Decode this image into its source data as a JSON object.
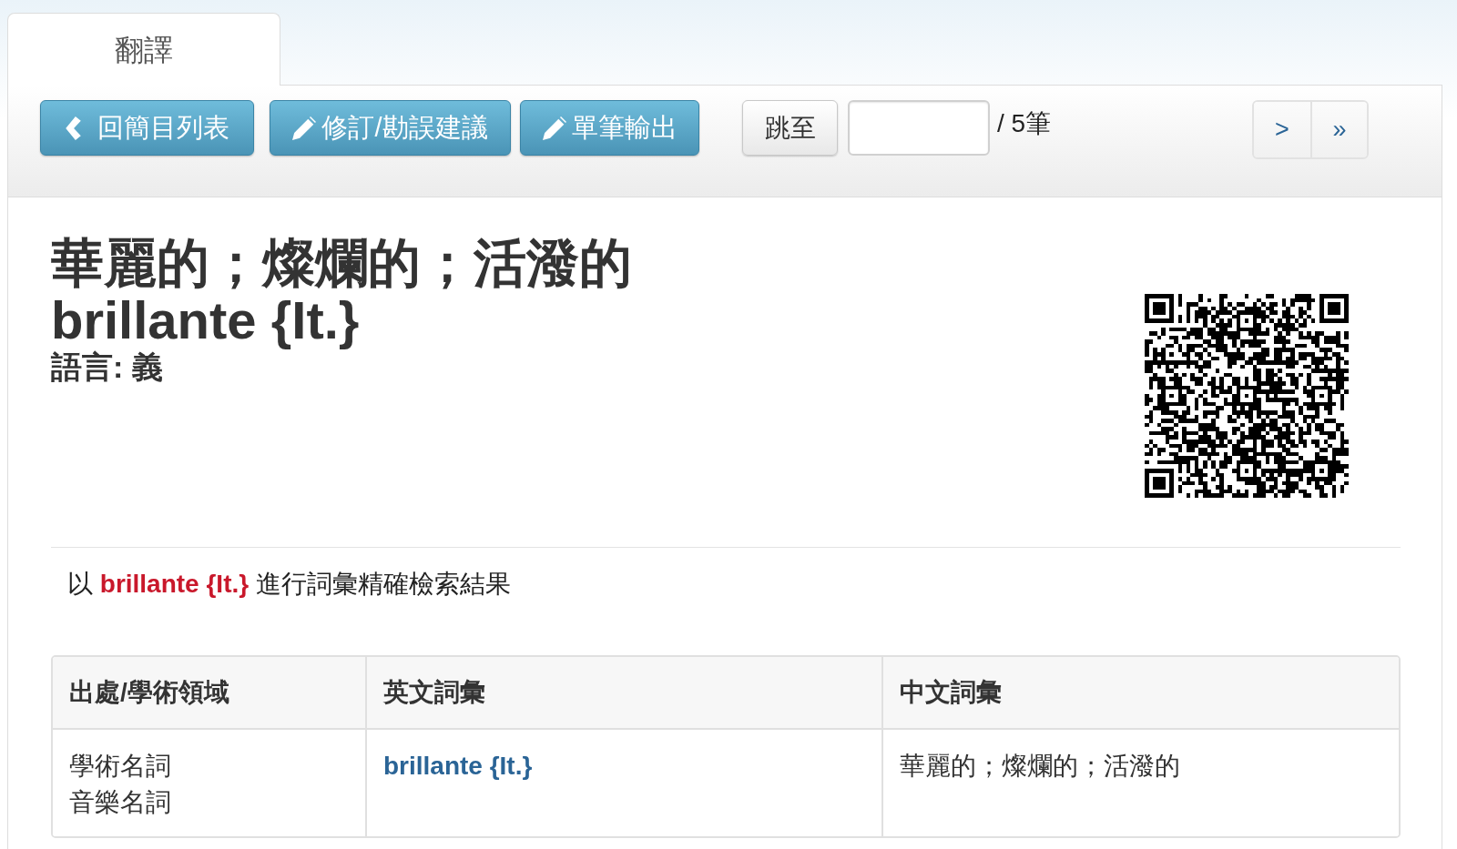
{
  "tabs": [
    {
      "label": "翻譯",
      "selected": true
    }
  ],
  "toolbar": {
    "buttons": [
      {
        "kind": "back",
        "label": "回簡目列表"
      },
      {
        "kind": "edit",
        "label": "修訂/勘誤建議"
      },
      {
        "kind": "edit",
        "label": "單筆輸出"
      }
    ],
    "jump": {
      "button": "跳至",
      "total": "/ 5筆"
    },
    "pager": [
      ">",
      "»"
    ]
  },
  "entry": {
    "title": "華麗的；燦爛的；活潑的",
    "term": "brillante {It.}",
    "language": "語言: 義"
  },
  "search_result": "以 **brillante {It.}** 進行詞彙精確檢索結果",
  "table": {
    "columns": [
      "出處/學術領域",
      "英文詞彙",
      "中文詞彙"
    ],
    "rows": [
      {
        "fields": [
          "學術名詞",
          "音樂名詞"
        ],
        "english": "brillante {It.}",
        "chinese": "華麗的；燦爛的；活潑的"
      }
    ]
  }
}
